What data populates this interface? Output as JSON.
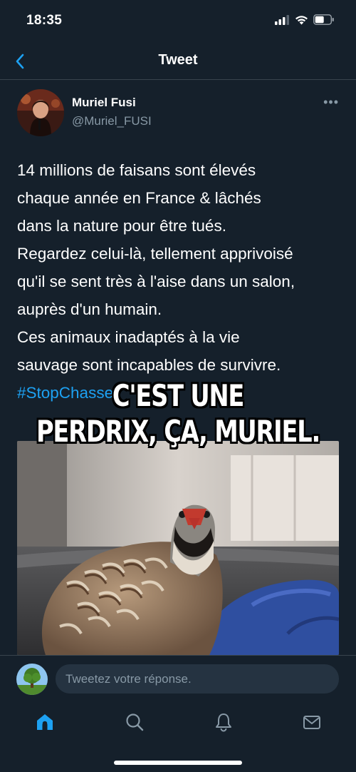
{
  "status": {
    "time": "18:35"
  },
  "header": {
    "title": "Tweet"
  },
  "tweet": {
    "author_name": "Muriel Fusi",
    "author_handle": "@Muriel_FUSI",
    "lines": [
      "14 millions de faisans sont élevés",
      "chaque année en France & lâchés",
      "dans la nature pour être tués.",
      "Regardez celui-là, tellement apprivoisé",
      "qu'il se sent très à l'aise dans un salon,",
      "auprès d'un humain.",
      "Ces animaux inadaptés à la vie",
      "sauvage sont incapables de survivre."
    ],
    "hashtag": "#StopChasse"
  },
  "meme": {
    "line1": "C'EST UNE",
    "line2": "PERDRIX, ÇA, MURIEL."
  },
  "reply": {
    "placeholder": "Tweetez votre réponse."
  },
  "tabs": [
    {
      "icon": "home-icon",
      "active": true
    },
    {
      "icon": "search-icon",
      "active": false
    },
    {
      "icon": "bell-icon",
      "active": false
    },
    {
      "icon": "mail-icon",
      "active": false
    }
  ],
  "colors": {
    "background": "#15202b",
    "accent": "#1da1f2",
    "muted": "#8899a6",
    "divider": "#38444d"
  }
}
